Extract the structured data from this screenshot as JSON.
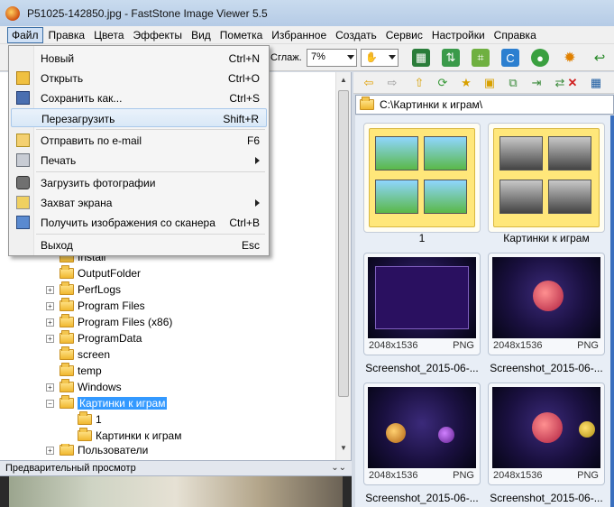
{
  "window": {
    "title": "P51025-142850.jpg  -  FastStone Image Viewer 5.5"
  },
  "menu": [
    "Файл",
    "Правка",
    "Цвета",
    "Эффекты",
    "Вид",
    "Пометка",
    "Избранное",
    "Создать",
    "Сервис",
    "Настройки",
    "Справка"
  ],
  "toolbar": {
    "smooth_label": "Сглаж.",
    "zoom_value": "7%"
  },
  "file_menu": [
    {
      "label": "Новый",
      "shortcut": "Ctrl+N",
      "icon": "new-icon"
    },
    {
      "label": "Открыть",
      "shortcut": "Ctrl+O",
      "icon": "open-icon"
    },
    {
      "label": "Сохранить как...",
      "shortcut": "Ctrl+S",
      "icon": "save-icon"
    },
    {
      "label": "Перезагрузить",
      "shortcut": "Shift+R",
      "icon": ""
    },
    {
      "label": "Отправить по e-mail",
      "shortcut": "F6",
      "icon": "email-icon"
    },
    {
      "label": "Печать",
      "shortcut": "",
      "icon": "print-icon"
    },
    {
      "label": "Загрузить фотографии",
      "shortcut": "",
      "icon": "camera-icon"
    },
    {
      "label": "Захват экрана",
      "shortcut": "",
      "icon": "screen-capture-icon"
    },
    {
      "label": "Получить изображения со сканера",
      "shortcut": "Ctrl+B",
      "icon": "scanner-icon"
    },
    {
      "label": "Выход",
      "shortcut": "Esc",
      "icon": ""
    }
  ],
  "tree": [
    {
      "label": "Install",
      "expander": "",
      "indent": 1
    },
    {
      "label": "OutputFolder",
      "expander": "",
      "indent": 1
    },
    {
      "label": "PerfLogs",
      "expander": "+",
      "indent": 1
    },
    {
      "label": "Program Files",
      "expander": "+",
      "indent": 1
    },
    {
      "label": "Program Files (x86)",
      "expander": "+",
      "indent": 1
    },
    {
      "label": "ProgramData",
      "expander": "+",
      "indent": 1
    },
    {
      "label": "screen",
      "expander": "",
      "indent": 1
    },
    {
      "label": "temp",
      "expander": "",
      "indent": 1
    },
    {
      "label": "Windows",
      "expander": "+",
      "indent": 1
    },
    {
      "label": "Картинки к играм",
      "expander": "−",
      "indent": 1,
      "selected": true
    },
    {
      "label": "1",
      "expander": "",
      "indent": 2
    },
    {
      "label": "Картинки к играм",
      "expander": "",
      "indent": 2
    },
    {
      "label": "Пользователи",
      "expander": "+",
      "indent": 1
    }
  ],
  "preview": {
    "label": "Предварительный просмотр"
  },
  "path": "C:\\Картинки к играм\\",
  "thumbnails": [
    {
      "caption": "1",
      "kind": "folder"
    },
    {
      "caption": "Картинки к играм",
      "kind": "folder"
    },
    {
      "caption": "Screenshot_2015-06-...",
      "dims": "2048x1536",
      "format": "PNG",
      "kind": "image"
    },
    {
      "caption": "Screenshot_2015-06-...",
      "dims": "2048x1536",
      "format": "PNG",
      "kind": "image"
    },
    {
      "caption": "Screenshot_2015-06-...",
      "dims": "2048x1536",
      "format": "PNG",
      "kind": "image"
    },
    {
      "caption": "Screenshot_2015-06-...",
      "dims": "2048x1536",
      "format": "PNG",
      "kind": "image"
    }
  ]
}
